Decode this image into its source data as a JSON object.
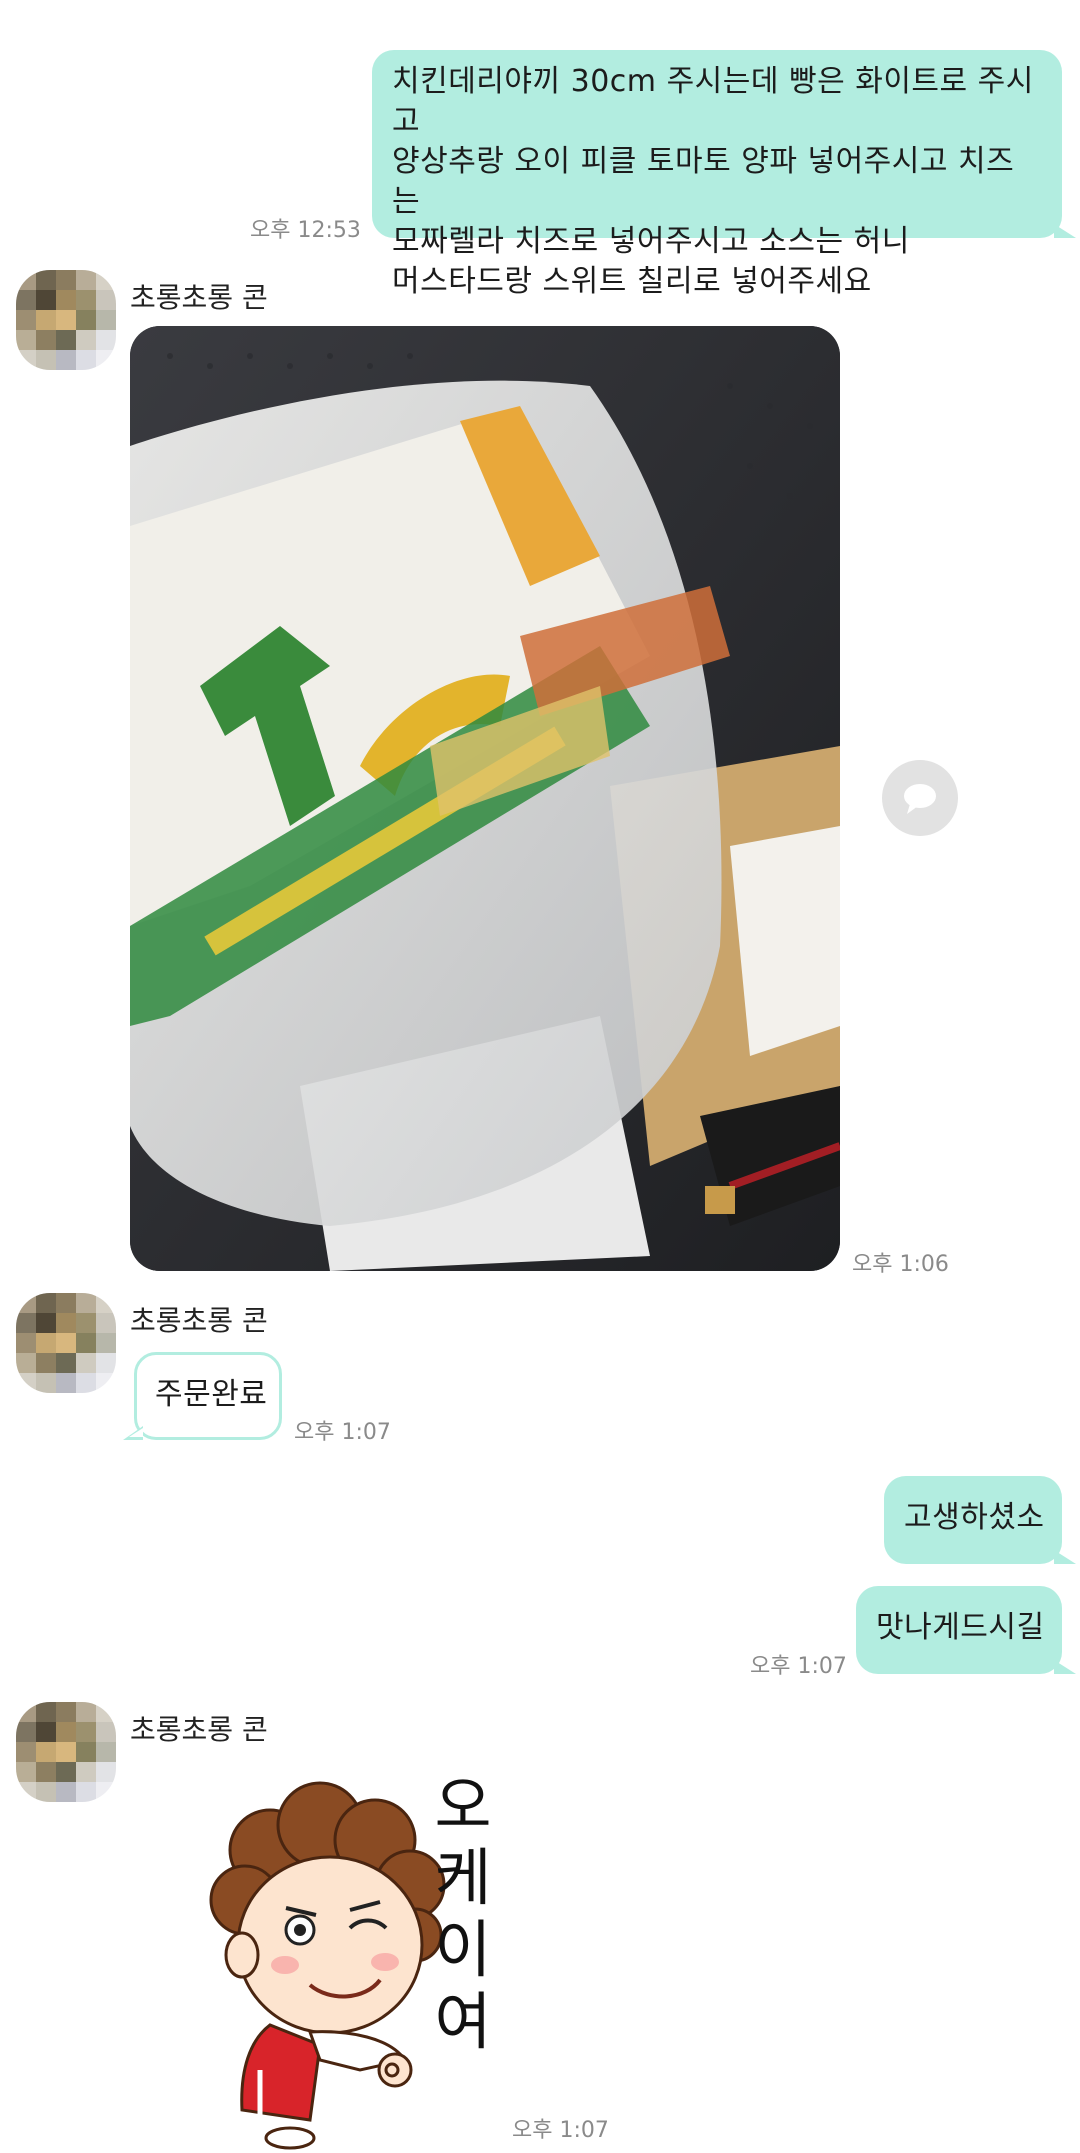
{
  "messages": {
    "m1": {
      "lines": [
        "치킨데리야끼 30cm 주시는데 빵은 화이트로 주시고",
        "양상추랑 오이 피클 토마토 양파 넣어주시고 치즈는",
        "모짜렐라 치즈로 넣어주시고 소스는 허니",
        "머스타드랑 스위트 칠리로 넣어주세요"
      ],
      "time": "오후 12:53"
    },
    "m2": {
      "sender": "초롱초롱 콘",
      "photo_icon": "subway-bag-photo",
      "time": "오후 1:06"
    },
    "m3": {
      "sender": "초롱초롱 콘",
      "text": "주문완료",
      "time": "오후 1:07"
    },
    "m4": {
      "text": "고생하셨소"
    },
    "m5": {
      "text": "맛나게드시길",
      "time": "오후 1:07"
    },
    "m6": {
      "sender": "초롱초롱 콘",
      "sticker_text": [
        "오",
        "케",
        "이",
        "여"
      ],
      "sticker_icon": "curly-hair-ok-sticker",
      "time": "오후 1:07"
    }
  },
  "icons": {
    "share": "speech-bubble-icon"
  },
  "colors": {
    "bubble_out": "#b2ede0",
    "bubble_in_border": "#b2ede0",
    "time_text": "#8a8a8a"
  }
}
